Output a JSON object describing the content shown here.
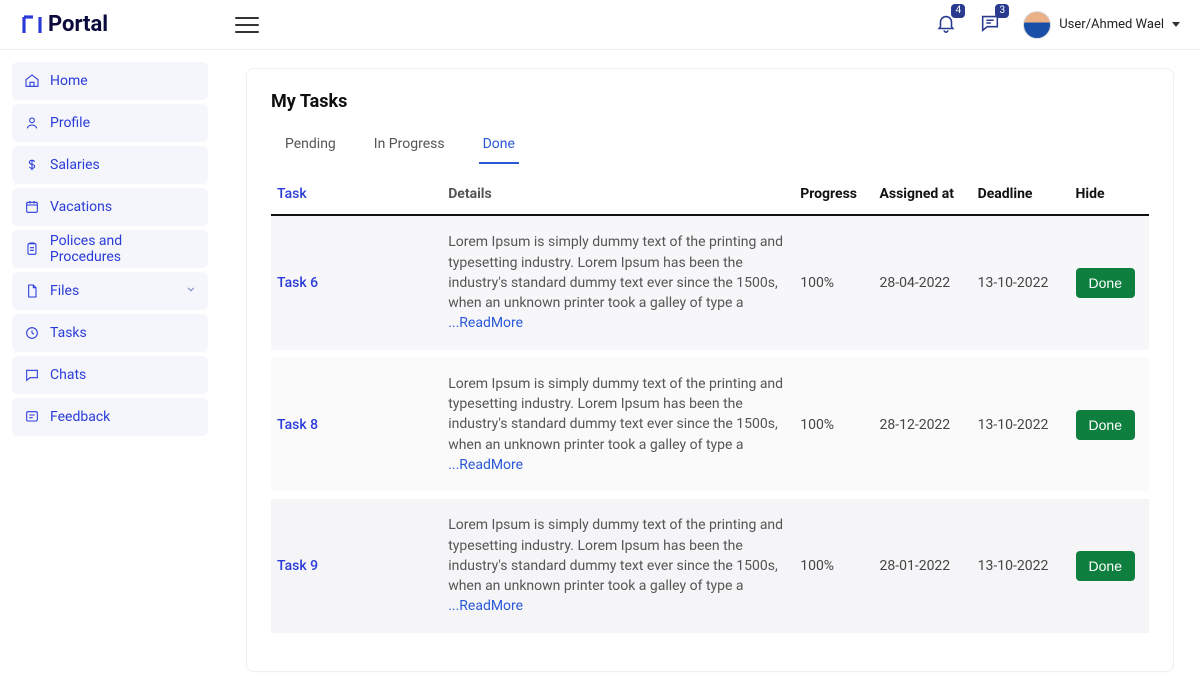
{
  "app_name": "Portal",
  "header": {
    "bell_count": "4",
    "chat_count": "3",
    "user_label": "User/Ahmed Wael"
  },
  "sidebar": {
    "items": [
      {
        "label": "Home",
        "icon": "home"
      },
      {
        "label": "Profile",
        "icon": "user"
      },
      {
        "label": "Salaries",
        "icon": "dollar"
      },
      {
        "label": "Vacations",
        "icon": "calendar"
      },
      {
        "label": "Polices and Procedures",
        "icon": "clipboard"
      },
      {
        "label": "Files",
        "icon": "file",
        "expandable": true
      },
      {
        "label": "Tasks",
        "icon": "clock"
      },
      {
        "label": "Chats",
        "icon": "chat"
      },
      {
        "label": "Feedback",
        "icon": "feedback"
      }
    ]
  },
  "page": {
    "title": "My Tasks",
    "tabs": [
      "Pending",
      "In Progress",
      "Done"
    ],
    "active_tab": "Done",
    "columns": [
      "Task",
      "Details",
      "Progress",
      "Assigned at",
      "Deadline",
      "Hide"
    ],
    "details_text": "Lorem Ipsum is simply dummy text of the printing and typesetting industry. Lorem Ipsum has been the industry's standard dummy text ever since the 1500s, when an unknown printer took a galley of type a ",
    "readmore_label": "...ReadMore",
    "rows": [
      {
        "task": "Task 6",
        "progress": "100%",
        "assigned": "28-04-2022",
        "deadline": "13-10-2022",
        "hide_label": "Done"
      },
      {
        "task": "Task 8",
        "progress": "100%",
        "assigned": "28-12-2022",
        "deadline": "13-10-2022",
        "hide_label": "Done"
      },
      {
        "task": "Task 9",
        "progress": "100%",
        "assigned": "28-01-2022",
        "deadline": "13-10-2022",
        "hide_label": "Done"
      }
    ]
  }
}
